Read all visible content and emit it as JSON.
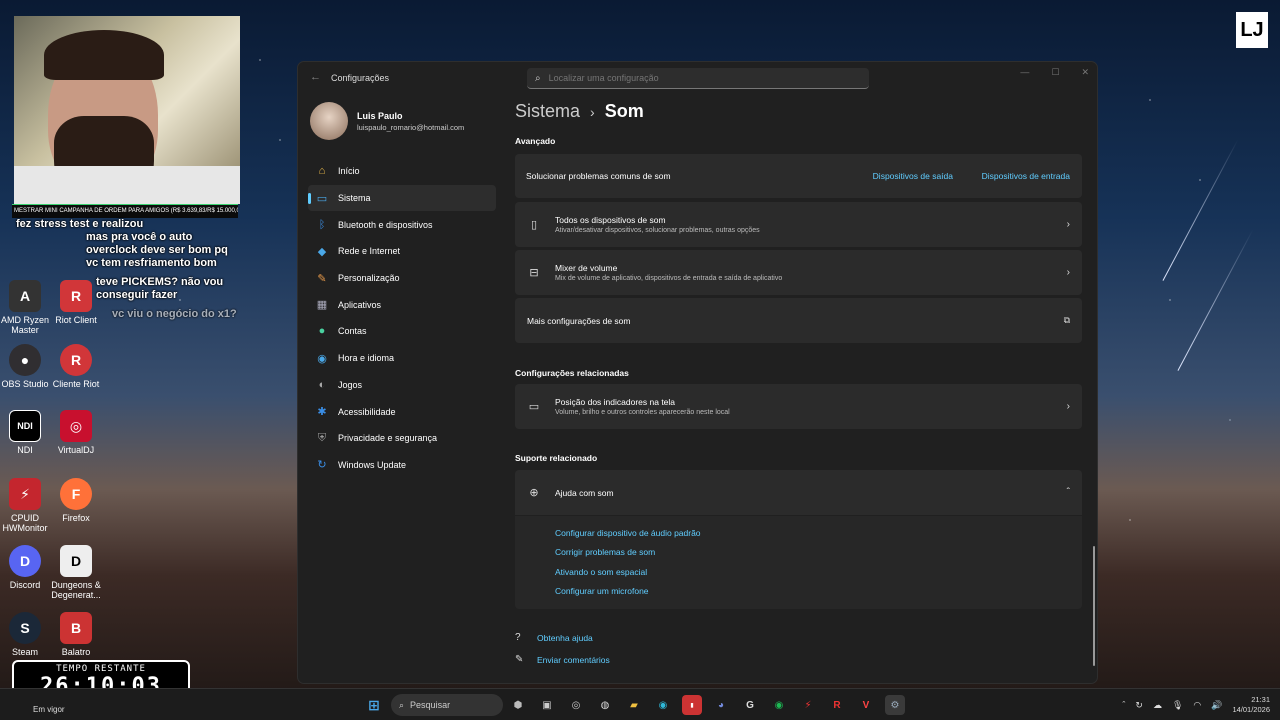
{
  "desktop": {
    "icons": [
      {
        "label": "AMD Ryzen Master",
        "icon": "amd-icon"
      },
      {
        "label": "Riot Client",
        "icon": "riot-icon"
      },
      {
        "label": "OBS Studio",
        "icon": "obs-icon"
      },
      {
        "label": "Cliente Riot",
        "icon": "riot-icon"
      },
      {
        "label": "NDI",
        "icon": "ndi-icon"
      },
      {
        "label": "VirtualDJ",
        "icon": "virtualdj-icon"
      },
      {
        "label": "CPUID HWMonitor",
        "icon": "hwmonitor-icon"
      },
      {
        "label": "Firefox",
        "icon": "firefox-icon"
      },
      {
        "label": "Discord",
        "icon": "discord-icon"
      },
      {
        "label": "Dungeons & Degenerat...",
        "icon": "dungeons-icon"
      },
      {
        "label": "Steam",
        "icon": "steam-icon"
      },
      {
        "label": "Balatro",
        "icon": "balatro-icon"
      }
    ]
  },
  "stream": {
    "ticker": "MESTRAR MINI CAMPANHA DE ORDEM PARA AMIGOS (R$ 3.639,83/R$ 15.000,00)",
    "chat": [
      "fez stress test e realizou",
      "mas pra você o auto overclock deve ser bom pq vc tem resfriamento bom",
      "teve PICKEMS? não vou conseguir fazer",
      "vc viu o negócio do x1?"
    ],
    "timer_label": "TEMPO RESTANTE",
    "timer_value": "26:10:03"
  },
  "window": {
    "app_title": "Configurações",
    "search_placeholder": "Localizar uma configuração",
    "profile": {
      "name": "Luis Paulo",
      "email": "luispaulo_romario@hotmail.com"
    },
    "nav": [
      {
        "label": "Início",
        "icon": "home-icon"
      },
      {
        "label": "Sistema",
        "icon": "system-icon",
        "active": true
      },
      {
        "label": "Bluetooth e dispositivos",
        "icon": "bluetooth-icon"
      },
      {
        "label": "Rede e Internet",
        "icon": "network-icon"
      },
      {
        "label": "Personalização",
        "icon": "brush-icon"
      },
      {
        "label": "Aplicativos",
        "icon": "apps-icon"
      },
      {
        "label": "Contas",
        "icon": "account-icon"
      },
      {
        "label": "Hora e idioma",
        "icon": "globe-clock-icon"
      },
      {
        "label": "Jogos",
        "icon": "gamepad-icon"
      },
      {
        "label": "Acessibilidade",
        "icon": "accessibility-icon"
      },
      {
        "label": "Privacidade e segurança",
        "icon": "shield-icon"
      },
      {
        "label": "Windows Update",
        "icon": "update-icon"
      }
    ],
    "breadcrumb": {
      "parent": "Sistema",
      "current": "Som"
    },
    "advanced": {
      "heading": "Avançado",
      "troubleshoot": "Solucionar problemas comuns de som",
      "output_link": "Dispositivos de saída",
      "input_link": "Dispositivos de entrada",
      "all_devices_title": "Todos os dispositivos de som",
      "all_devices_desc": "Ativar/desativar dispositivos, solucionar problemas, outras opções",
      "mixer_title": "Mixer de volume",
      "mixer_desc": "Mix de volume de aplicativo, dispositivos de entrada e saída de aplicativo",
      "more_settings": "Mais configurações de som"
    },
    "related": {
      "heading": "Configurações relacionadas",
      "indicator_title": "Posição dos indicadores na tela",
      "indicator_desc": "Volume, brilho e outros controles aparecerão neste local"
    },
    "support": {
      "heading": "Suporte relacionado",
      "help_title": "Ajuda com som",
      "links": [
        "Configurar dispositivo de áudio padrão",
        "Corrigir problemas de som",
        "Ativando o som espacial",
        "Configurar um microfone"
      ]
    },
    "footer": {
      "get_help": "Obtenha ajuda",
      "feedback": "Enviar comentários"
    }
  },
  "taskbar": {
    "search_label": "Pesquisar",
    "em_vigor": "Em vigor",
    "time": "21:31",
    "date": "14/01/2026"
  },
  "colors": {
    "accent": "#60cdff",
    "window_bg": "#202020",
    "card_bg": "#2b2b2b"
  }
}
